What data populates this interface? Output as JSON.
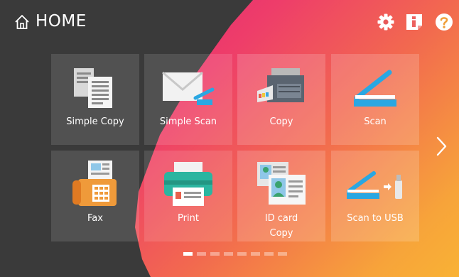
{
  "header": {
    "title": "HOME",
    "icons": [
      "home-icon",
      "settings-icon",
      "info-icon",
      "help-icon"
    ]
  },
  "apps": [
    {
      "label": "Simple Copy",
      "icon": "simple-copy-icon"
    },
    {
      "label": "Simple Scan",
      "icon": "simple-scan-icon"
    },
    {
      "label": "Copy",
      "icon": "copier-icon"
    },
    {
      "label": "Scan",
      "icon": "scanner-icon"
    },
    {
      "label": "Fax",
      "icon": "fax-icon"
    },
    {
      "label": "Print",
      "icon": "printer-icon"
    },
    {
      "label": "ID card",
      "label2": "Copy",
      "icon": "id-card-copy-icon"
    },
    {
      "label": "Scan to USB",
      "icon": "scan-to-usb-icon"
    }
  ],
  "pager": {
    "pages": 8,
    "current": 1
  },
  "colors": {
    "background_dark": "#3a3a3a",
    "gradient": [
      "#d9157a",
      "#ee3d6a",
      "#f2694f",
      "#f7a43a"
    ],
    "scanner_blue": "#2aa7e2",
    "printer_teal": "#2bb5a0"
  }
}
